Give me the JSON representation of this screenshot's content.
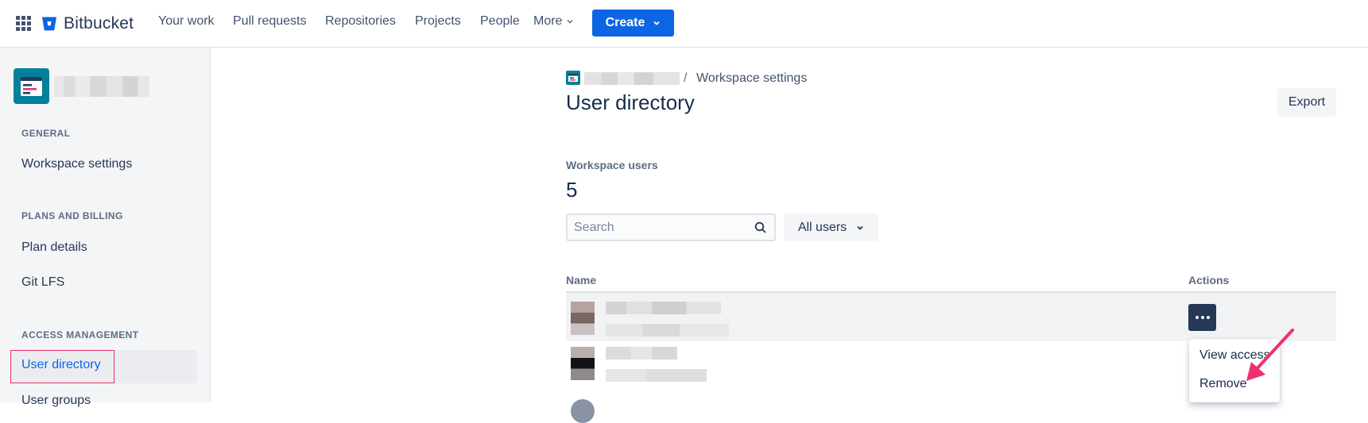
{
  "topnav": {
    "brand": "Bitbucket",
    "items": [
      "Your work",
      "Pull requests",
      "Repositories",
      "Projects",
      "People"
    ],
    "more_label": "More",
    "create_label": "Create"
  },
  "sidebar": {
    "sections": {
      "general": "GENERAL",
      "plans": "PLANS AND BILLING",
      "access": "ACCESS MANAGEMENT"
    },
    "links": {
      "workspace_settings": "Workspace settings",
      "plan_details": "Plan details",
      "git_lfs": "Git LFS",
      "user_directory": "User directory",
      "user_groups": "User groups"
    },
    "active": "User directory"
  },
  "main": {
    "breadcrumb": {
      "separator": "/",
      "current": "Workspace settings"
    },
    "title": "User directory",
    "export_label": "Export",
    "workspace_users_label": "Workspace users",
    "workspace_users_count": "5",
    "search": {
      "placeholder": "Search",
      "value": ""
    },
    "filter_label": "All users",
    "table": {
      "headers": {
        "name": "Name",
        "actions": "Actions"
      }
    },
    "actions_menu": {
      "items": [
        "View access",
        "Remove"
      ]
    }
  },
  "colors": {
    "primary": "#0C66E4",
    "highlight_border": "#E5306C",
    "annotation_arrow": "#F0306E",
    "workspace_avatar": "#00819B"
  },
  "icons": {
    "apps": "grid-icon",
    "brand": "bitbucket-logo-icon",
    "search": "search-icon",
    "more": "more-horizontal-icon"
  }
}
